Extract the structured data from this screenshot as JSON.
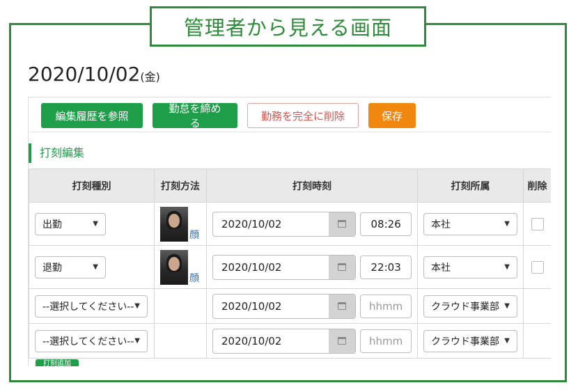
{
  "callout": "管理者から見える画面",
  "date": {
    "main": "2020/10/02",
    "dow": "(金)"
  },
  "toolbar": {
    "history": "編集履歴を参照",
    "close": "勤怠を締める",
    "delete": "勤務を完全に削除",
    "save": "保存"
  },
  "section_title": "打刻編集",
  "columns": [
    "打刻種別",
    "打刻方法",
    "打刻時刻",
    "打刻所属",
    "削除"
  ],
  "rows": [
    {
      "type": "出勤",
      "method": "顔",
      "date": "2020/10/02",
      "time": "08:26",
      "org": "本社"
    },
    {
      "type": "退勤",
      "method": "顔",
      "date": "2020/10/02",
      "time": "22:03",
      "org": "本社"
    },
    {
      "type": "--選択してください--",
      "date": "2020/10/02",
      "time_placeholder": "hhmm",
      "org": "クラウド事業部"
    },
    {
      "type": "--選択してください--",
      "date": "2020/10/02",
      "time_placeholder": "hhmm",
      "org": "クラウド事業部"
    }
  ],
  "add_button": "打刻追加",
  "colors": {
    "accent": "#2e8b3a",
    "button_green": "#1f9e4a",
    "save": "#f0880f",
    "danger": "#d9534f"
  }
}
